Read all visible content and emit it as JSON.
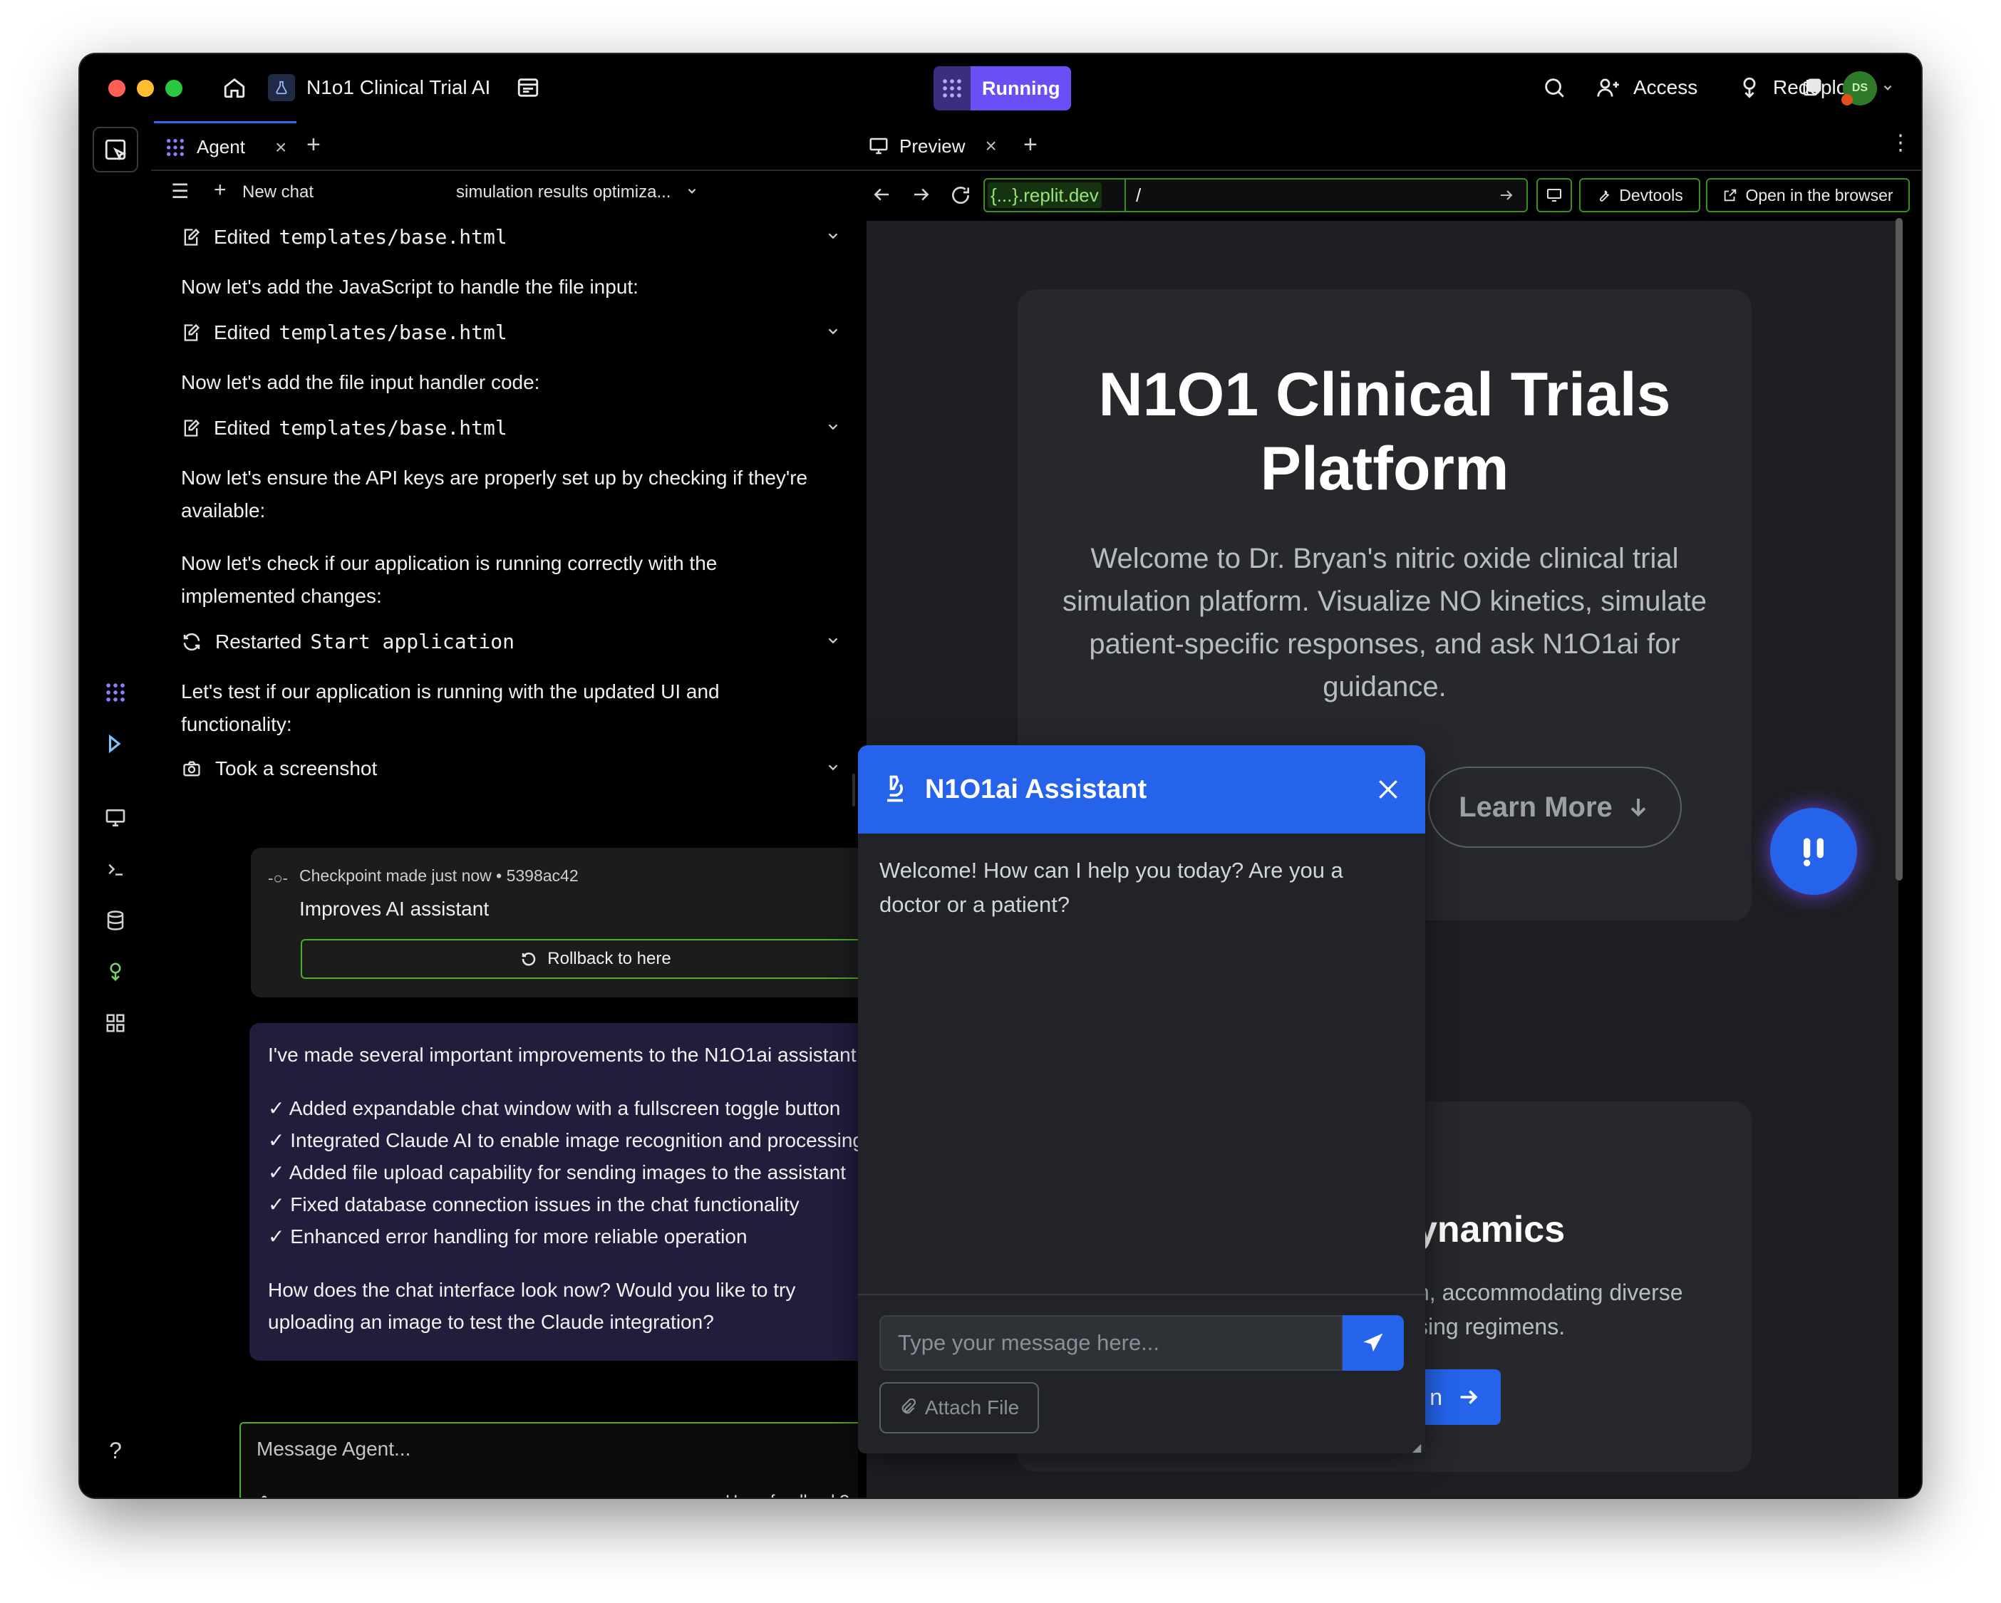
{
  "titlebar": {
    "project_name": "N1o1 Clinical Trial AI",
    "status": "Running",
    "access_label": "Access",
    "redeploy_label": "Redeploy",
    "avatar_initials": "DS"
  },
  "agent": {
    "tab_label": "Agent",
    "new_chat_label": "New chat",
    "chat_title": "simulation results optimiza...",
    "feed": [
      {
        "kind": "tool",
        "icon": "edit-file-icon",
        "verb": "Edited",
        "target": "templates/base.html"
      },
      {
        "kind": "text",
        "text": "Now let's add the JavaScript to handle the file input:"
      },
      {
        "kind": "tool",
        "icon": "edit-file-icon",
        "verb": "Edited",
        "target": "templates/base.html"
      },
      {
        "kind": "text",
        "text": "Now let's add the file input handler code:"
      },
      {
        "kind": "tool",
        "icon": "edit-file-icon",
        "verb": "Edited",
        "target": "templates/base.html"
      },
      {
        "kind": "text",
        "text": "Now let's ensure the API keys are properly set up by checking if they're available:"
      },
      {
        "kind": "text",
        "text": "Now let's check if our application is running correctly with the implemented changes:"
      },
      {
        "kind": "tool",
        "icon": "restart-icon",
        "verb": "Restarted",
        "target": "Start application"
      },
      {
        "kind": "text",
        "text": "Let's test if our application is running with the updated UI and functionality:"
      },
      {
        "kind": "tool",
        "icon": "camera-icon",
        "verb": "Took a screenshot",
        "target": ""
      }
    ],
    "checkpoint": {
      "meta": "Checkpoint made just now • 5398ac42",
      "title": "Improves AI assistant",
      "rollback_label": "Rollback to here"
    },
    "summary": {
      "intro": "I've made several important improvements to the N1O1ai assistant:",
      "items": [
        "✓ Added expandable chat window with a fullscreen toggle button",
        "✓ Integrated Claude AI to enable image recognition and processing",
        "✓ Added file upload capability for sending images to the assistant",
        "✓ Fixed database connection issues in the chat functionality",
        "✓ Enhanced error handling for more reliable operation"
      ],
      "outro": "How does the chat interface look now? Would you like to try uploading an image to test the Claude integration?"
    },
    "composer": {
      "placeholder": "Message Agent...",
      "feedback_label": "Have feedback?"
    }
  },
  "preview": {
    "tab_label": "Preview",
    "url_domain": "{...}.replit.dev",
    "url_path": "/",
    "devtools_label": "Devtools",
    "open_browser_label": "Open in the browser",
    "site": {
      "hero_title": "N1O1 Clinical Trials Platform",
      "hero_subtitle": "Welcome to Dr. Bryan's nitric oxide clinical trial simulation platform. Visualize NO kinetics, simulate patient-specific responses, and ask N1O1ai for guidance.",
      "learn_more_label": "Learn More",
      "card2_title_fragment": "ynamics",
      "card2_text_line1": "n, accommodating diverse",
      "card2_text_line2": "sing regimens.",
      "card2_button_fragment": "n"
    },
    "chat_widget": {
      "title": "N1O1ai Assistant",
      "welcome": "Welcome! How can I help you today? Are you a doctor or a patient?",
      "input_placeholder": "Type your message here...",
      "attach_label": "Attach File"
    }
  },
  "colors": {
    "accent_blue": "#2563eb",
    "running_purple": "#6a4ef6",
    "border_green": "#4caf2c",
    "summary_bg": "#221c3d"
  }
}
